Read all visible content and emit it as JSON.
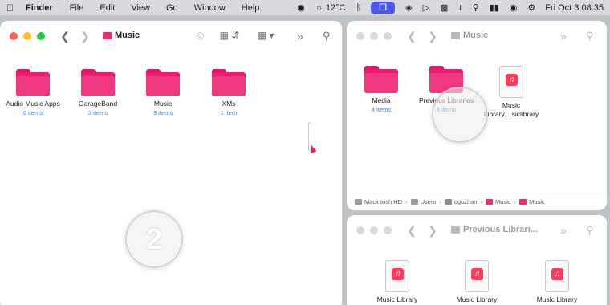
{
  "menubar": {
    "apple_icon": "apple-icon",
    "app_name": "Finder",
    "menus": [
      "File",
      "Edit",
      "View",
      "Go",
      "Window",
      "Help"
    ],
    "status": {
      "temperature": "12°C",
      "datetime": "Fri Oct 3  08:35"
    }
  },
  "main_window": {
    "title": "Music",
    "items": [
      {
        "name": "Audio Music Apps",
        "count": "6 items"
      },
      {
        "name": "GarageBand",
        "count": "3 items"
      },
      {
        "name": "Music",
        "count": "3 items"
      },
      {
        "name": "XMs",
        "count": "1 item"
      }
    ],
    "step_number": "2"
  },
  "top_right_window": {
    "title": "Music",
    "items": [
      {
        "name": "Media",
        "count": "4 items"
      },
      {
        "name": "Previous Libraries",
        "count": "4 items"
      },
      {
        "name": "Music",
        "name2": "Library....siclibrary",
        "count": ""
      }
    ],
    "path": [
      "Macintosh HD",
      "Users",
      "oguzhan",
      "Music",
      "Music"
    ]
  },
  "bottom_right_window": {
    "title": "Previous Librari...",
    "items": [
      {
        "name": "Music Library"
      },
      {
        "name": "Music Library"
      },
      {
        "name": "Music Library"
      }
    ]
  }
}
